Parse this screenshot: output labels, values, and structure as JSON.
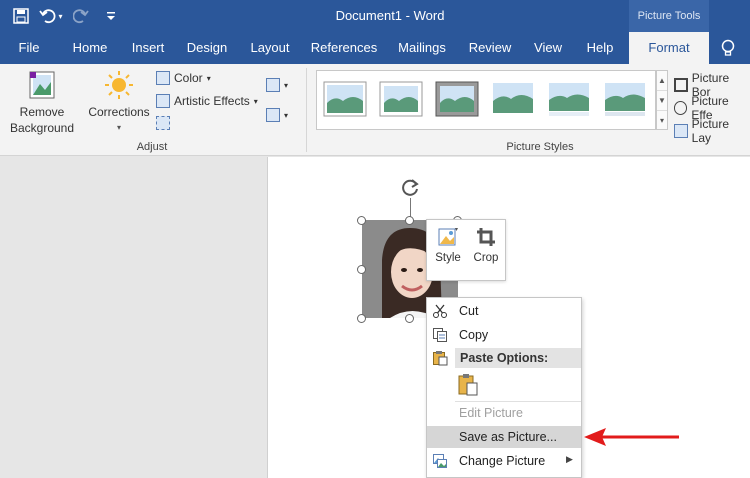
{
  "titlebar": {
    "document_title": "Document1  -  Word",
    "context_group": "Picture Tools",
    "qat": {
      "save_icon": "save-icon",
      "undo_icon": "undo-icon",
      "redo_icon": "redo-icon",
      "customize_icon": "customize-icon"
    }
  },
  "tabs": [
    {
      "label": "File"
    },
    {
      "label": "Home"
    },
    {
      "label": "Insert"
    },
    {
      "label": "Design"
    },
    {
      "label": "Layout"
    },
    {
      "label": "References"
    },
    {
      "label": "Mailings"
    },
    {
      "label": "Review"
    },
    {
      "label": "View"
    },
    {
      "label": "Help"
    },
    {
      "label": "Format",
      "active": true
    }
  ],
  "ribbon": {
    "remove_background": {
      "line1": "Remove",
      "line2": "Background"
    },
    "corrections": "Corrections",
    "color": "Color",
    "artistic_effects": "Artistic Effects",
    "adjust_group": "Adjust",
    "picture_styles_group": "Picture Styles",
    "picture_border": "Picture Bor",
    "picture_effects": "Picture Effe",
    "picture_layout": "Picture Lay"
  },
  "mini_toolbar": {
    "style": "Style",
    "crop": "Crop"
  },
  "context_menu": {
    "cut": "Cut",
    "copy": "Copy",
    "paste_options": "Paste Options:",
    "edit_picture": "Edit Picture",
    "save_as_picture": "Save as Picture...",
    "change_picture": "Change Picture"
  },
  "colors": {
    "accent": "#2b579a",
    "arrow": "#e21b1b"
  }
}
